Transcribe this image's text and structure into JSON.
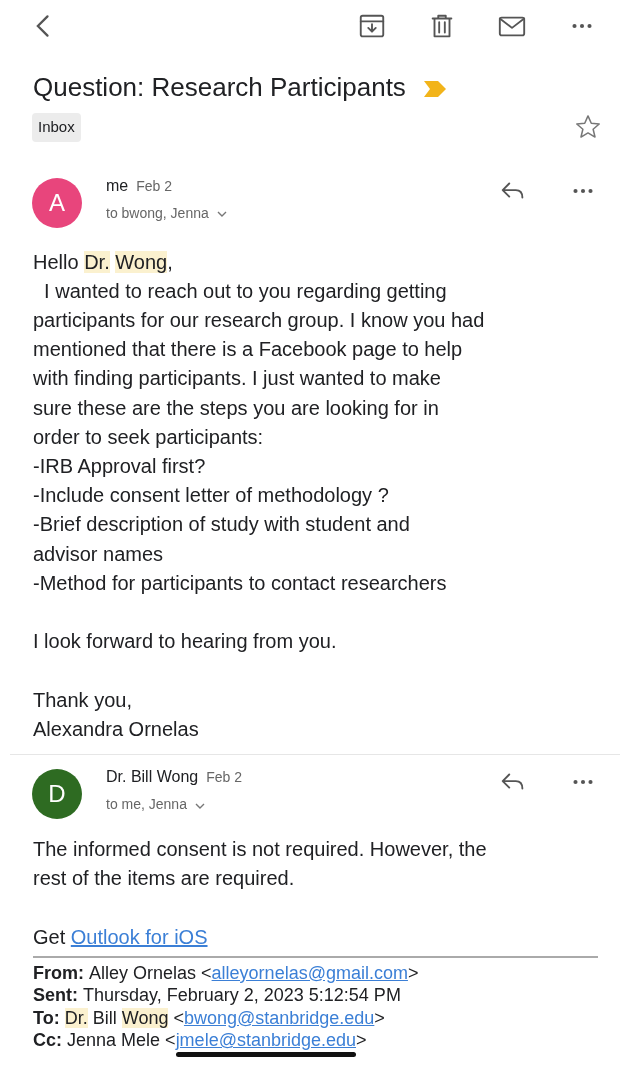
{
  "toolbar": {
    "actions": [
      {
        "kind": "archive"
      },
      {
        "kind": "delete"
      },
      {
        "kind": "mail"
      },
      {
        "kind": "more"
      }
    ]
  },
  "subject": {
    "title": "Question: Research Participants",
    "important": true,
    "starred": false,
    "label": "Inbox"
  },
  "messages": [
    {
      "avatar_letter": "A",
      "color": "#e8457c",
      "sender": "me",
      "date": "Feb 2",
      "recipients": "to bwong, Jenna",
      "paragraphs": [
        [
          [
            {
              "text": "Hello "
            },
            {
              "text": "Dr.",
              "highlighted": true
            },
            {
              "text": "Wong",
              "highlighted": true,
              "spaced": true
            },
            {
              "text": ","
            }
          ],
          [
            {
              "text": "  I wanted to reach out to you regarding getting"
            }
          ],
          [
            {
              "text": "participants for our research group. I know you had"
            }
          ],
          [
            {
              "text": "mentioned that there is a Facebook page to help"
            }
          ],
          [
            {
              "text": "with finding participants. I just wanted to make"
            }
          ],
          [
            {
              "text": "sure these are the steps you are looking for in"
            }
          ],
          [
            {
              "text": "order to seek participants:"
            }
          ],
          [
            {
              "text": "-IRB Approval first?"
            }
          ],
          [
            {
              "text": "-Include consent letter of methodology ?"
            }
          ],
          [
            {
              "text": "-Brief description of study with student and"
            }
          ],
          [
            {
              "text": "advisor names"
            }
          ],
          [
            {
              "text": "-Method for participants to contact researchers"
            }
          ]
        ],
        [
          [
            {
              "text": "I look forward to hearing from you."
            }
          ]
        ],
        [
          [
            {
              "text": "Thank you,"
            }
          ],
          [
            {
              "text": "Alexandra Ornelas"
            }
          ]
        ]
      ]
    },
    {
      "avatar_letter": "D",
      "color": "#2e6b22",
      "sender": "Dr. Bill Wong",
      "date": "Feb 2",
      "recipients": "to me, Jenna",
      "paragraphs": [
        [
          [
            {
              "text": "The informed consent is not required. However, the"
            }
          ],
          [
            {
              "text": "rest of the items are required."
            }
          ]
        ],
        [
          [
            {
              "text": "Get "
            },
            {
              "text": "Outlook for iOS",
              "link": true
            }
          ]
        ]
      ],
      "quoted_header": [
        {
          "label": "From:",
          "parts": [
            {
              "text": "Alley Ornelas <"
            },
            {
              "text": "alleyornelas@gmail.com",
              "link": true
            },
            {
              "text": ">"
            }
          ]
        },
        {
          "label": "Sent:",
          "parts": [
            {
              "text": "Thursday, February 2, 2023 5:12:54 PM"
            }
          ]
        },
        {
          "label": "To:",
          "parts": [
            {
              "text": "Dr.",
              "highlighted": true
            },
            {
              "text": " Bill "
            },
            {
              "text": "Wong",
              "highlighted": true
            },
            {
              "text": " <"
            },
            {
              "text": "bwong@stanbridge.edu",
              "link": true
            },
            {
              "text": ">"
            }
          ]
        },
        {
          "label": "Cc:",
          "parts": [
            {
              "text": "Jenna Mele <"
            },
            {
              "text": "jmele@stanbridge.edu",
              "link": true,
              "marked": true
            },
            {
              "text": ">"
            }
          ]
        }
      ]
    }
  ]
}
